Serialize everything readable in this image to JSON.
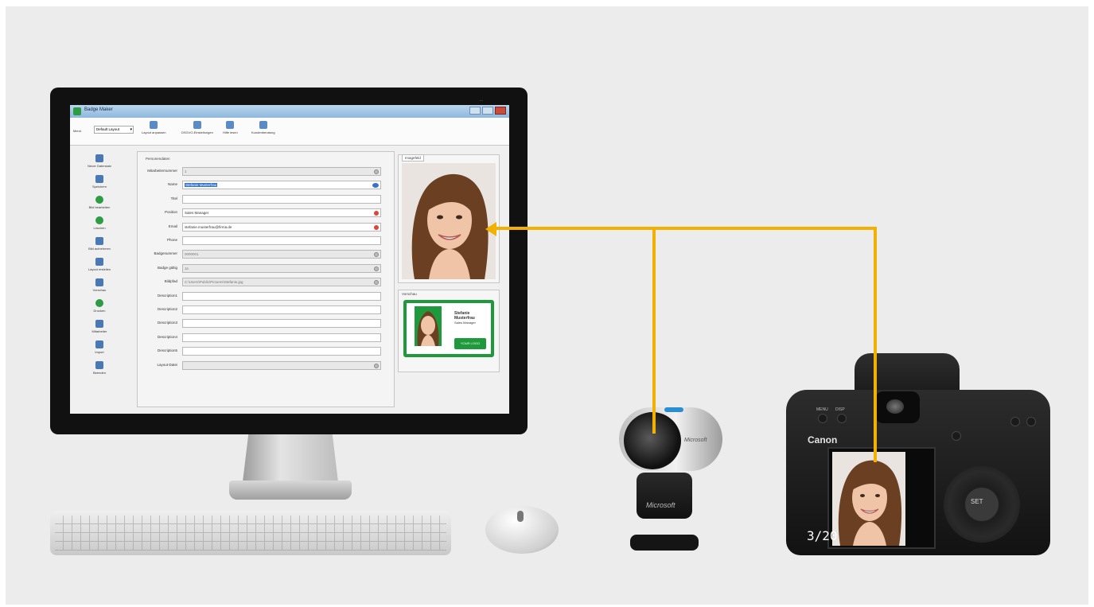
{
  "app": {
    "title": "Badge Maker",
    "window_controls": [
      "minimize",
      "maximize",
      "close"
    ],
    "ribbon": {
      "menu_label": "Menü",
      "layout_select": "Default Layout",
      "buttons": [
        {
          "label": "Layout anpassen",
          "icon": "layout-icon"
        },
        {
          "label": "DSGVO-Einstellungen",
          "icon": "privacy-icon"
        },
        {
          "label": "Hilfe lesen",
          "icon": "help-icon"
        },
        {
          "label": "Kundenberatung",
          "icon": "support-icon"
        }
      ]
    },
    "sidebar": [
      {
        "label": "Neuer Datensatz",
        "icon": "new-record-icon"
      },
      {
        "label": "Speichern",
        "icon": "save-icon"
      },
      {
        "label": "Bild bearbeiten",
        "icon": "edit-image-icon"
      },
      {
        "label": "Löschen",
        "icon": "delete-icon"
      },
      {
        "label": "Bild aufnehmen",
        "icon": "capture-icon"
      },
      {
        "label": "Layout erstellen",
        "icon": "layout-create-icon"
      },
      {
        "label": "Vorschau",
        "icon": "preview-icon"
      },
      {
        "label": "Drucken",
        "icon": "print-icon"
      },
      {
        "label": "Mitarbeiter",
        "icon": "staff-icon"
      },
      {
        "label": "Import",
        "icon": "import-icon"
      },
      {
        "label": "Beenden",
        "icon": "exit-icon"
      }
    ],
    "form": {
      "section_title": "Personendaten",
      "fields": [
        {
          "label": "Mitarbeiternummer",
          "value": "1",
          "state": "disabled",
          "marker": "clear"
        },
        {
          "label": "Name",
          "value": "Stefanie Musterfrau",
          "state": "selected",
          "marker": "required"
        },
        {
          "label": "Titel",
          "value": "",
          "state": "normal",
          "marker": ""
        },
        {
          "label": "Position",
          "value": "Sales Manager",
          "state": "normal",
          "marker": "required"
        },
        {
          "label": "Email",
          "value": "stefanie.musterfrau@firma.de",
          "state": "normal",
          "marker": "required"
        },
        {
          "label": "Phone",
          "value": "",
          "state": "normal",
          "marker": ""
        },
        {
          "label": "Badgenummer",
          "value": "0000001",
          "state": "disabled",
          "marker": "clear"
        },
        {
          "label": "Badge gültig",
          "value": "Ja",
          "state": "disabled",
          "marker": "clear"
        },
        {
          "label": "Bildpfad",
          "value": "C:\\Users\\Public\\Pictures\\Stefanie.jpg",
          "state": "disabled",
          "marker": "clear"
        },
        {
          "label": "Description1",
          "value": "",
          "state": "normal",
          "marker": ""
        },
        {
          "label": "Description2",
          "value": "",
          "state": "normal",
          "marker": ""
        },
        {
          "label": "Description3",
          "value": "",
          "state": "normal",
          "marker": ""
        },
        {
          "label": "Description4",
          "value": "",
          "state": "normal",
          "marker": ""
        },
        {
          "label": "Description5",
          "value": "",
          "state": "normal",
          "marker": ""
        },
        {
          "label": "Layout-Datei",
          "value": "",
          "state": "disabled",
          "marker": "search"
        }
      ]
    },
    "image_panel": {
      "tab_label": "Imagefeld"
    },
    "preview_panel": {
      "tab_label": "Vorschau",
      "card_name_line1": "Stefanie",
      "card_name_line2": "Musterfrau",
      "card_role": "Sales Manager",
      "card_logo": "YOUR LOGO",
      "accent_color": "#1e9a3c"
    },
    "connector_color": "#f2b000"
  },
  "devices": {
    "webcam_brand": "Microsoft",
    "camera_brand": "Canon",
    "camera_counter": "3/20",
    "camera_dial_label": "SET",
    "camera_buttons": [
      "MENU",
      "DISP"
    ]
  }
}
